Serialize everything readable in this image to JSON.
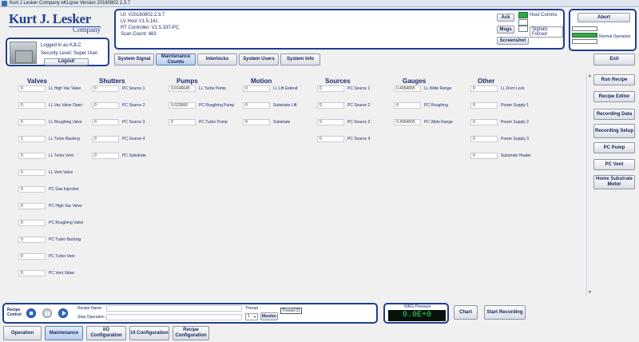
{
  "window": {
    "title": "Kurt J Lesker Company eKLipse Version 20160802 2.3.7"
  },
  "logo": {
    "line1": "Kurt J. Lesker",
    "line2": "Company"
  },
  "user": {
    "logged_in": "Logged in as KJLC",
    "security": "Security Level: Super User",
    "logout": "Logout"
  },
  "info": {
    "ui": "UI: V20160802.2.3.7",
    "lv_host": "LV Host V1.5.141",
    "rt": "RT Controller: V1.5.337-PC",
    "scan": "Scan Count: 483",
    "ack": "Ack",
    "msgs": "Msgs",
    "screenshot": "Screenshot",
    "host_comms": "Host Comms",
    "signals_forced": "Signals Forced"
  },
  "status": {
    "abort": "Abort",
    "normal": "Normal Operation"
  },
  "tabs": [
    "System Signal",
    "Maintenance Counts",
    "Interlocks",
    "System Users",
    "System Info"
  ],
  "exit": "Exit",
  "right_buttons": [
    "Run Recipe",
    "Recipe Editor",
    "Recording Data",
    "Recording Setup",
    "PC Pump",
    "PC Vent",
    "Home Substrate Motor"
  ],
  "columns": {
    "valves": {
      "title": "Valves",
      "rows": [
        {
          "v": "0",
          "l": "LL High Vac Valve"
        },
        {
          "v": "0",
          "l": "LL Vac Valve Open"
        },
        {
          "v": "0",
          "l": "LL Roughing Valve"
        },
        {
          "v": "1",
          "l": "LL Turbo Backing"
        },
        {
          "v": "0",
          "l": "LL Turbo Vent"
        },
        {
          "v": "0",
          "l": "LL Vent Valve"
        },
        {
          "v": "0",
          "l": "PC Gas Injection"
        },
        {
          "v": "0",
          "l": "PC High Vac Valve"
        },
        {
          "v": "0",
          "l": "PC Roughing Valve"
        },
        {
          "v": "0",
          "l": "PC Turbo Backing"
        },
        {
          "v": "0",
          "l": "PC Turbo Vent"
        },
        {
          "v": "0",
          "l": "PC Vent Valve"
        }
      ]
    },
    "shutters": {
      "title": "Shutters",
      "rows": [
        {
          "v": "0",
          "l": "PC Source 1"
        },
        {
          "v": "0",
          "l": "PC Source 2"
        },
        {
          "v": "0",
          "l": "PC Source 3"
        },
        {
          "v": "0",
          "l": "PC Source 4"
        },
        {
          "v": "0",
          "l": "PC Substrate"
        }
      ]
    },
    "pumps": {
      "title": "Pumps",
      "rows": [
        {
          "v": "0.0146645",
          "l": "LL Turbo Pump"
        },
        {
          "v": "0.023606",
          "l": "PC Roughing Pump"
        },
        {
          "v": "0",
          "l": "PC Turbo Pump"
        }
      ]
    },
    "motion": {
      "title": "Motion",
      "rows": [
        {
          "v": "0",
          "l": "LL Lift Extend"
        },
        {
          "v": "0",
          "l": "Substrate Lift"
        },
        {
          "v": "0",
          "l": "Substrate"
        }
      ]
    },
    "sources": {
      "title": "Sources",
      "rows": [
        {
          "v": "0",
          "l": "PC Source 1"
        },
        {
          "v": "0",
          "l": "PC Source 2"
        },
        {
          "v": "0",
          "l": "PC Source 3"
        },
        {
          "v": "0",
          "l": "PC Source 4"
        }
      ]
    },
    "gauges": {
      "title": "Gauges",
      "rows": [
        {
          "v": "0.4954655",
          "l": "LL Wide Range"
        },
        {
          "v": "0",
          "l": "PC Roughing"
        },
        {
          "v": "0.4954655",
          "l": "PC Wide Range"
        }
      ]
    },
    "other": {
      "title": "Other",
      "rows": [
        {
          "v": "0",
          "l": "LL Door Lock"
        },
        {
          "v": "0",
          "l": "Power Supply 1"
        },
        {
          "v": "0",
          "l": "Power Supply 2"
        },
        {
          "v": "0",
          "l": "Power Supply 3"
        },
        {
          "v": "0",
          "l": "Substrate Heater"
        }
      ]
    }
  },
  "recipe": {
    "title": "Recipe Control",
    "name_label": "Recipe Name",
    "step_label": "Step Operation",
    "thread_label": "Thread",
    "thread_value": "1",
    "monitor": "Monitor",
    "thread_badge": "Thread 01"
  },
  "pressure": {
    "label": "WRG Pressure",
    "value": "0.0E+0"
  },
  "chart": "Chart",
  "start_recording": "Start Recording",
  "bottom_tabs": [
    "Operation",
    "Maintenance",
    "I/O Configuration",
    "UI Configuration",
    "Recipe Configuration"
  ]
}
